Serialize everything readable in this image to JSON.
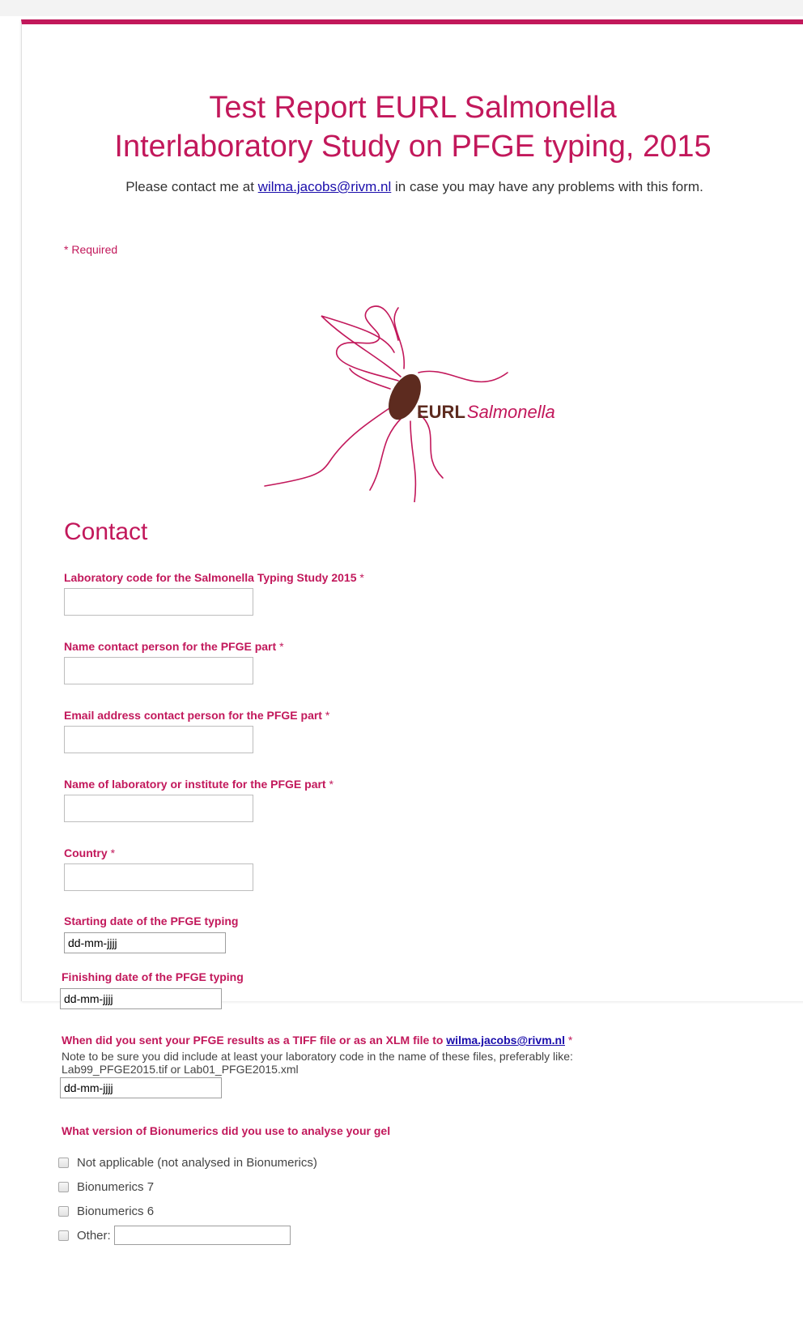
{
  "form": {
    "title_line1": "Test Report EURL Salmonella",
    "title_line2": "Interlaboratory Study on PFGE typing, 2015",
    "description_before": "Please contact me at ",
    "description_link": "wilma.jacobs@rivm.nl",
    "description_after": " in case you may have any problems with this form.",
    "required_note": "* Required",
    "accent_color": "#c2185b"
  },
  "logo": {
    "icon": "salmonella-bacterium-logo",
    "text_bold": "EURL",
    "text_italic": "Salmonella",
    "body_color": "#5d2b1f",
    "flagella_color": "#c2185b"
  },
  "section": {
    "title": "Contact"
  },
  "questions": {
    "lab_code": {
      "label": "Laboratory code for the Salmonella Typing Study 2015",
      "star": "*",
      "value": ""
    },
    "contact_name": {
      "label": "Name contact person for the PFGE part",
      "star": "*",
      "value": ""
    },
    "contact_email": {
      "label": "Email address contact person for the PFGE part",
      "star": "*",
      "value": ""
    },
    "lab_name": {
      "label": "Name of laboratory or institute for the PFGE part",
      "star": "*",
      "value": ""
    },
    "country": {
      "label": "Country",
      "star": "*",
      "value": ""
    },
    "start_date": {
      "label": "Starting date of the PFGE typing",
      "value": "dd-mm-jjjj"
    },
    "finish_date": {
      "label": "Finishing date of the PFGE typing",
      "value": "dd-mm-jjjj"
    },
    "sent_date": {
      "label_before": "When did you sent your PFGE results as a TIFF file or as an XLM file to ",
      "label_link": "wilma.jacobs@rivm.nl",
      "star": "*",
      "help_line1": "Note to be sure you did include at least your laboratory code in the name of these files, preferably like:",
      "help_line2": "Lab99_PFGE2015.tif or Lab01_PFGE2015.xml",
      "value": "dd-mm-jjjj"
    },
    "bionumerics": {
      "label": "What version of Bionumerics did you use to analyse your gel",
      "options": [
        "Not applicable (not analysed in Bionumerics)",
        "Bionumerics 7",
        "Bionumerics 6",
        "Other:"
      ],
      "other_value": ""
    }
  }
}
